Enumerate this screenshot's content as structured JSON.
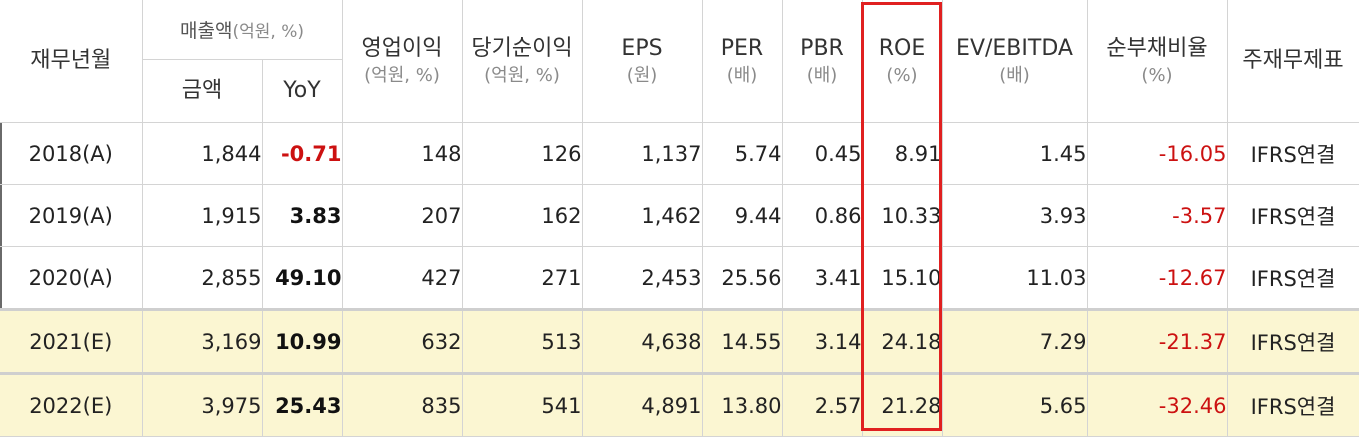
{
  "headers": {
    "period": "재무년월",
    "sales": "매출액",
    "sales_unit": "(억원, %)",
    "amount": "금액",
    "yoy": "YoY",
    "op_income": {
      "label": "영업이익",
      "unit": "(억원, %)"
    },
    "net_income": {
      "label": "당기순이익",
      "unit": "(억원, %)"
    },
    "eps": {
      "label": "EPS",
      "unit": "(원)"
    },
    "per": {
      "label": "PER",
      "unit": "(배)"
    },
    "pbr": {
      "label": "PBR",
      "unit": "(배)"
    },
    "roe": {
      "label": "ROE",
      "unit": "(%)"
    },
    "ev_ebitda": {
      "label": "EV/EBITDA",
      "unit": "(배)"
    },
    "net_debt": {
      "label": "순부채비율",
      "unit": "(%)"
    },
    "basis": "주재무제표"
  },
  "highlight_color": "#e02020",
  "negative_color": "#cc1111",
  "estimate_row_color": "#fbf6d2",
  "rows": [
    {
      "period": "2018(A)",
      "amount": "1,844",
      "yoy": "-0.71",
      "op_income": "148",
      "net_income": "126",
      "eps": "1,137",
      "per": "5.74",
      "pbr": "0.45",
      "roe": "8.91",
      "ev_ebitda": "1.45",
      "net_debt": "-16.05",
      "basis": "IFRS연결"
    },
    {
      "period": "2019(A)",
      "amount": "1,915",
      "yoy": "3.83",
      "op_income": "207",
      "net_income": "162",
      "eps": "1,462",
      "per": "9.44",
      "pbr": "0.86",
      "roe": "10.33",
      "ev_ebitda": "3.93",
      "net_debt": "-3.57",
      "basis": "IFRS연결"
    },
    {
      "period": "2020(A)",
      "amount": "2,855",
      "yoy": "49.10",
      "op_income": "427",
      "net_income": "271",
      "eps": "2,453",
      "per": "25.56",
      "pbr": "3.41",
      "roe": "15.10",
      "ev_ebitda": "11.03",
      "net_debt": "-12.67",
      "basis": "IFRS연결"
    },
    {
      "period": "2021(E)",
      "amount": "3,169",
      "yoy": "10.99",
      "op_income": "632",
      "net_income": "513",
      "eps": "4,638",
      "per": "14.55",
      "pbr": "3.14",
      "roe": "24.18",
      "ev_ebitda": "7.29",
      "net_debt": "-21.37",
      "basis": "IFRS연결"
    },
    {
      "period": "2022(E)",
      "amount": "3,975",
      "yoy": "25.43",
      "op_income": "835",
      "net_income": "541",
      "eps": "4,891",
      "per": "13.80",
      "pbr": "2.57",
      "roe": "21.28",
      "ev_ebitda": "5.65",
      "net_debt": "-32.46",
      "basis": "IFRS연결"
    }
  ]
}
